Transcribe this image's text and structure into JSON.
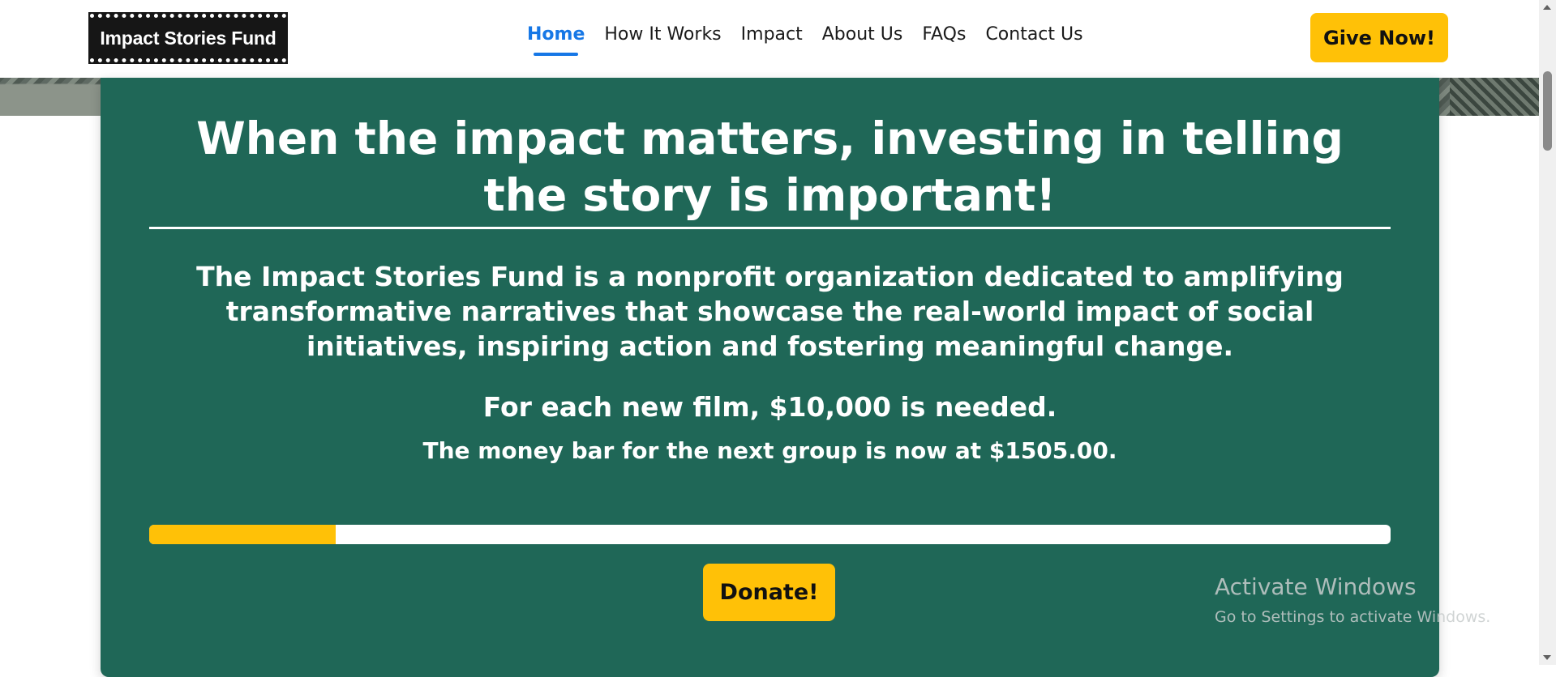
{
  "navbar": {
    "logo_text": "Impact Stories Fund",
    "links": [
      {
        "label": "Home",
        "active": true
      },
      {
        "label": "How It Works",
        "active": false
      },
      {
        "label": "Impact",
        "active": false
      },
      {
        "label": "About Us",
        "active": false
      },
      {
        "label": "FAQs",
        "active": false
      },
      {
        "label": "Contact Us",
        "active": false
      }
    ],
    "cta_label": "Give Now!"
  },
  "hero": {
    "headline": "When the impact matters, investing in telling the story is important!",
    "mission": "The Impact Stories Fund is a nonprofit organization dedicated to amplifying transformative narratives that showcase the real-world impact of social initiatives, inspiring action and fostering meaningful change.",
    "needed_text": "For each new film, $10,000 is needed.",
    "bar_status_prefix": "The money bar for the next group is now at ",
    "bar_status_amount": "$1505.00",
    "bar_status_suffix": ".",
    "progress_fraction": 0.15,
    "donate_label": "Donate!"
  },
  "colors": {
    "brand_green": "#1f6757",
    "accent_yellow": "#ffc107",
    "active_link_blue": "#1677e6"
  },
  "watermark": {
    "title": "Activate Windows",
    "subtitle": "Go to Settings to activate Windows."
  }
}
